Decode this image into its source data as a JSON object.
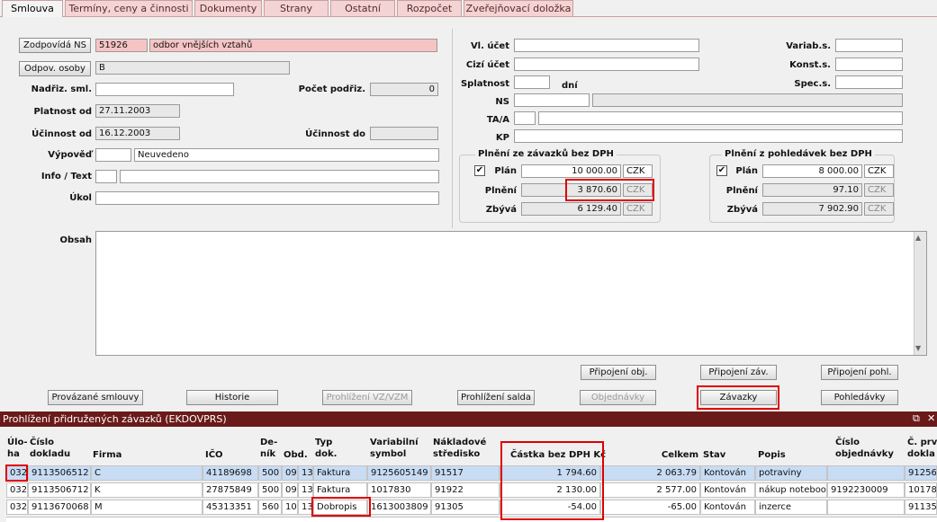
{
  "tabs": [
    "Smlouva",
    "Termíny, ceny a činnosti",
    "Dokumenty",
    "Strany",
    "Ostatní",
    "Rozpočet",
    "Zveřejňovací doložka"
  ],
  "left": {
    "zodpovida_btn": "Zodpovídá NS",
    "zodpovida_code": "51926",
    "zodpovida_name": "odbor vnějších vztahů",
    "odpov_btn": "Odpov. osoby",
    "odpov_value": "B",
    "nadriz_label": "Nadřiz. sml.",
    "nadriz_value": "",
    "pocet_label": "Počet podřiz.",
    "pocet_value": "0",
    "platnost_label": "Platnost od",
    "platnost_value": "27.11.2003",
    "ucinnost_od_label": "Účinnost od",
    "ucinnost_od_value": "16.12.2003",
    "ucinnost_do_label": "Účinnost do",
    "ucinnost_do_value": "",
    "vypoved_label": "Výpověď",
    "vypoved_code": "",
    "vypoved_value": "Neuvedeno",
    "info_label": "Info / Text",
    "info_code": "",
    "info_value": "",
    "ukol_label": "Úkol",
    "ukol_value": ""
  },
  "right": {
    "vl_ucet_label": "Vl. účet",
    "cizi_ucet_label": "Cizí účet",
    "splatnost_label": "Splatnost",
    "splatnost_unit": "dní",
    "ns_label": "NS",
    "taa_label": "TA/A",
    "kp_label": "KP",
    "variab_label": "Variab.s.",
    "konst_label": "Konst.s.",
    "spec_label": "Spec.s."
  },
  "plneni_zavazku": {
    "title": "Plnění ze závazků bez DPH",
    "plan_label": "Plán",
    "plan_value": "10 000.00",
    "plan_cur": "CZK",
    "plan_checked": "✔",
    "plneni_label": "Plnění",
    "plneni_value": "3 870.60",
    "plneni_cur": "CZK",
    "zbyva_label": "Zbývá",
    "zbyva_value": "6 129.40",
    "zbyva_cur": "CZK"
  },
  "plneni_pohledavek": {
    "title": "Plnění z pohledávek bez DPH",
    "plan_label": "Plán",
    "plan_value": "8 000.00",
    "plan_cur": "CZK",
    "plan_checked": "✔",
    "plneni_label": "Plnění",
    "plneni_value": "97.10",
    "plneni_cur": "CZK",
    "zbyva_label": "Zbývá",
    "zbyva_value": "7 902.90",
    "zbyva_cur": "CZK"
  },
  "obsah_label": "Obsah",
  "buttons_row1": {
    "pripojeni_obj": "Připojení obj.",
    "pripojeni_zav": "Připojení záv.",
    "pripojeni_pohl": "Připojení pohl."
  },
  "buttons_row2": {
    "provazane": "Provázané smlouvy",
    "historie": "Historie",
    "prohlizeni_vz": "Prohlížení VZ/VZM",
    "prohlizeni_salda": "Prohlížení salda",
    "objednavky": "Objednávky",
    "zavazky": "Závazky",
    "pohledavky": "Pohledávky"
  },
  "subwindow": {
    "title": "Prohlížení přidružených závazků (EKDOVPRS)",
    "restore_icon": "⧉",
    "close_icon": "✕"
  },
  "table": {
    "headers": {
      "uloha": "Úlo-\nha",
      "cislo_dokladu": "Číslo\ndokladu",
      "firma": "Firma",
      "ico": "IČO",
      "denik": "De-\nník",
      "obd": "Obd.",
      "typ": "Typ\ndok.",
      "vs": "Variabilní\nsymbol",
      "ns": "Nákladové\nstředisko",
      "castka": "Částka bez DPH Kč",
      "celkem": "Celkem",
      "stav": "Stav",
      "popis": "Popis",
      "cislo_obj": "Číslo\nobjednávky",
      "c_prv": "Č. prv\ndokla"
    },
    "rows": [
      {
        "uloha": "032",
        "cislo": "9113506512",
        "firma": "C",
        "ico": "41189698",
        "denik": "500",
        "obd1": "09",
        "obd2": "13",
        "typ": "Faktura",
        "vs": "9125605149",
        "ns": "91517",
        "castka": "1 794.60",
        "celkem": "2 063.79",
        "stav": "Kontován",
        "popis": "potraviny",
        "obj": "",
        "prv": "91256"
      },
      {
        "uloha": "032",
        "cislo": "9113506712",
        "firma": "K",
        "ico": "27875849",
        "denik": "500",
        "obd1": "09",
        "obd2": "13",
        "typ": "Faktura",
        "vs": "1017830",
        "ns": "91922",
        "castka": "2 130.00",
        "celkem": "2 577.00",
        "stav": "Kontován",
        "popis": "nákup notebook",
        "obj": "9192230009",
        "prv": "10178"
      },
      {
        "uloha": "032",
        "cislo": "9113670068",
        "firma": "M",
        "ico": "45313351",
        "denik": "560",
        "obd1": "10",
        "obd2": "13",
        "typ": "Dobropis",
        "vs": "1613003809",
        "ns": "91305",
        "castka": "-54.00",
        "celkem": "-65.00",
        "stav": "Kontován",
        "popis": "inzerce",
        "obj": "",
        "prv": "91135"
      }
    ]
  }
}
